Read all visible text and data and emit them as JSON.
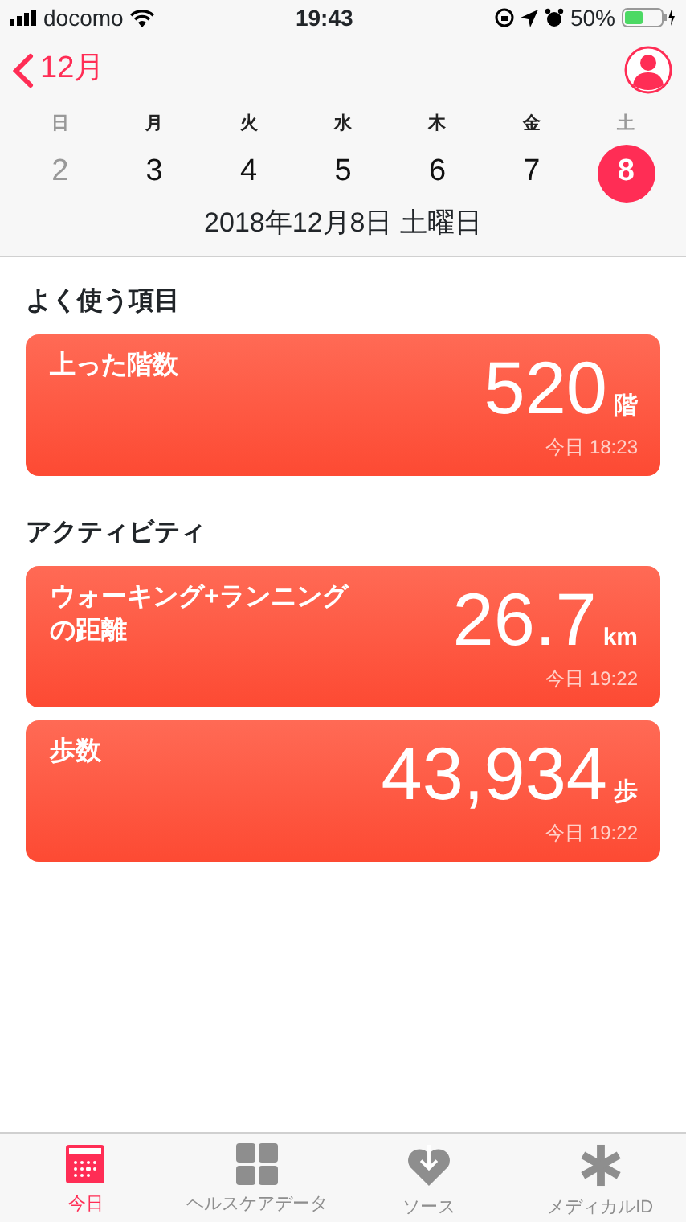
{
  "status_bar": {
    "carrier": "docomo",
    "time": "19:43",
    "battery": "50%"
  },
  "nav": {
    "back": "12月"
  },
  "week": [
    {
      "weekday": "日",
      "day": "2",
      "weekend": true,
      "selected": false
    },
    {
      "weekday": "月",
      "day": "3",
      "weekend": false,
      "selected": false
    },
    {
      "weekday": "火",
      "day": "4",
      "weekend": false,
      "selected": false
    },
    {
      "weekday": "水",
      "day": "5",
      "weekend": false,
      "selected": false
    },
    {
      "weekday": "木",
      "day": "6",
      "weekend": false,
      "selected": false
    },
    {
      "weekday": "金",
      "day": "7",
      "weekend": false,
      "selected": false
    },
    {
      "weekday": "土",
      "day": "8",
      "weekend": true,
      "selected": true
    }
  ],
  "date_title": "2018年12月8日 土曜日",
  "sections": [
    {
      "title": "よく使う項目",
      "cards": [
        {
          "title": "上った階数",
          "value": "520",
          "unit": "階",
          "time": "今日 18:23"
        }
      ]
    },
    {
      "title": "アクティビティ",
      "cards": [
        {
          "title": "ウォーキング+ランニングの距離",
          "value": "26.7",
          "unit": "km",
          "time": "今日 19:22"
        },
        {
          "title": "歩数",
          "value": "43,934",
          "unit": "歩",
          "time": "今日 19:22"
        }
      ]
    }
  ],
  "tabs": [
    {
      "label": "今日",
      "kind": "today",
      "selected": true
    },
    {
      "label": "ヘルスケアデータ",
      "kind": "data",
      "selected": false
    },
    {
      "label": "ソース",
      "kind": "sources",
      "selected": false
    },
    {
      "label": "メディカルID",
      "kind": "medical",
      "selected": false
    }
  ]
}
